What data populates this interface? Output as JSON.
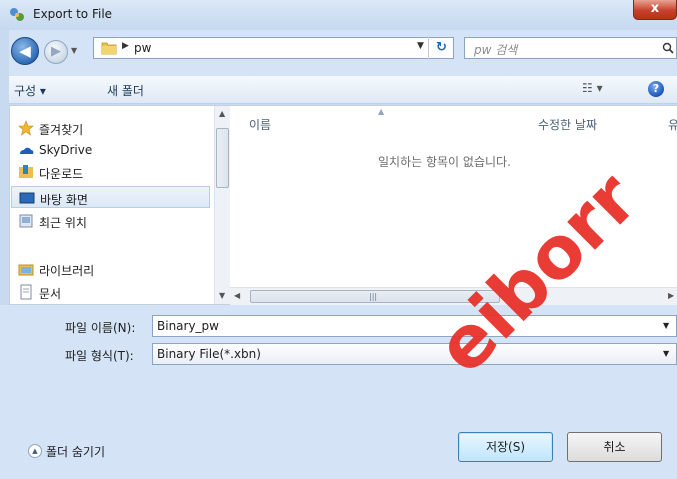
{
  "window": {
    "title": "Export to File",
    "close_label": "x"
  },
  "address": {
    "breadcrumb": [
      "pw"
    ],
    "search_placeholder": "pw 검색"
  },
  "toolbar": {
    "organize": "구성 ▾",
    "new_folder": "새 폴더",
    "views": "☷ ▾",
    "help": "?"
  },
  "nav": {
    "items": [
      {
        "label": "즐겨찾기",
        "icon": "star-icon"
      },
      {
        "label": "SkyDrive",
        "icon": "skydrive-icon"
      },
      {
        "label": "다운로드",
        "icon": "downloads-folder-icon"
      },
      {
        "label": "바탕 화면",
        "icon": "desktop-icon",
        "selected": true
      },
      {
        "label": "최근 위치",
        "icon": "recent-places-icon"
      },
      {
        "label": "라이브러리",
        "icon": "libraries-icon"
      },
      {
        "label": "문서",
        "icon": "documents-icon"
      }
    ]
  },
  "files": {
    "columns": [
      "이름",
      "수정한 날짜",
      "유"
    ],
    "empty_message": "일치하는 항목이 없습니다."
  },
  "form": {
    "filename_label": "파일 이름(N):",
    "filename_value": "Binary_pw",
    "filetype_label": "파일 형식(T):",
    "filetype_value": "Binary File(*.xbn)",
    "hide_folders": "폴더 숨기기",
    "save_button": "저장(S)",
    "cancel_button": "취소"
  },
  "watermark": {
    "text": "eiborr"
  },
  "colors": {
    "accent": "#3c7fb1",
    "watermark": "#e8322b",
    "close": "#c7422c"
  }
}
